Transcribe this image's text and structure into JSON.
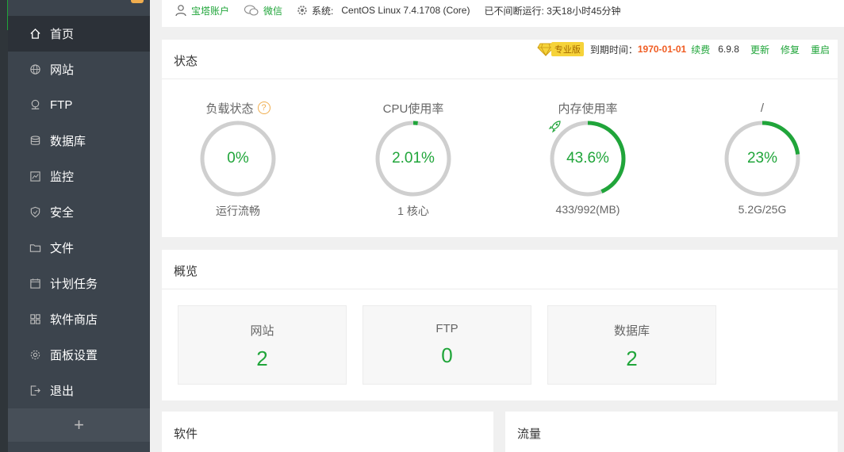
{
  "sidebar": {
    "items": [
      {
        "label": "首页",
        "icon": "home-icon"
      },
      {
        "label": "网站",
        "icon": "globe-icon"
      },
      {
        "label": "FTP",
        "icon": "ftp-icon"
      },
      {
        "label": "数据库",
        "icon": "database-icon"
      },
      {
        "label": "监控",
        "icon": "monitor-icon"
      },
      {
        "label": "安全",
        "icon": "shield-icon"
      },
      {
        "label": "文件",
        "icon": "folder-icon"
      },
      {
        "label": "计划任务",
        "icon": "calendar-icon"
      },
      {
        "label": "软件商店",
        "icon": "grid-icon"
      },
      {
        "label": "面板设置",
        "icon": "gear-icon"
      },
      {
        "label": "退出",
        "icon": "logout-icon"
      }
    ],
    "add_label": "+"
  },
  "topbar": {
    "account": "宝塔账户",
    "wechat": "微信",
    "system_label": "系统:",
    "system_value": "CentOS Linux 7.4.1708 (Core)",
    "uptime": "已不间断运行: 3天18小时45分钟"
  },
  "status": {
    "title": "状态",
    "pro_label": "专业版",
    "expire_label": "到期时间：",
    "expire_date": "1970-01-01",
    "renew": "续费",
    "version": "6.9.8",
    "update": "更新",
    "repair": "修复",
    "restart": "重启",
    "gauges": [
      {
        "label": "负载状态",
        "value": "0%",
        "sub": "运行流畅",
        "percent": 0,
        "help": "?"
      },
      {
        "label": "CPU使用率",
        "value": "2.01%",
        "sub": "1 核心",
        "percent": 2.01
      },
      {
        "label": "内存使用率",
        "value": "43.6%",
        "sub": "433/992(MB)",
        "percent": 43.6
      },
      {
        "label": "/",
        "value": "23%",
        "sub": "5.2G/25G",
        "percent": 23
      }
    ]
  },
  "overview": {
    "title": "概览",
    "cards": [
      {
        "label": "网站",
        "value": "2"
      },
      {
        "label": "FTP",
        "value": "0"
      },
      {
        "label": "数据库",
        "value": "2"
      }
    ]
  },
  "software": {
    "title": "软件"
  },
  "flow": {
    "title": "流量"
  },
  "colors": {
    "accent": "#20a53a",
    "sidebar_bg": "#3c444d",
    "sidebar_active": "#2c3138",
    "expire": "#f05d23",
    "pro_badge": "#f6d33a"
  }
}
